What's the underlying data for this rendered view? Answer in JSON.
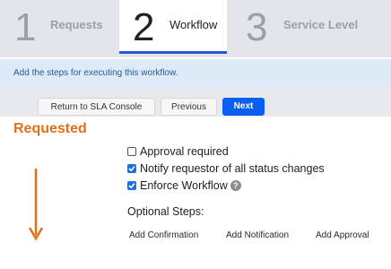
{
  "steps": [
    {
      "number": "1",
      "label": "Requests"
    },
    {
      "number": "2",
      "label": "Workflow"
    },
    {
      "number": "3",
      "label": "Service Level"
    }
  ],
  "active_step": 2,
  "banner": {
    "text": "Add the steps for executing this workflow."
  },
  "buttons": {
    "return_label": "Return to SLA Console",
    "previous_label": "Previous",
    "next_label": "Next"
  },
  "section": {
    "heading": "Requested",
    "checkboxes": [
      {
        "label": "Approval required",
        "checked": false
      },
      {
        "label": "Notify requestor of all status changes",
        "checked": true
      },
      {
        "label": "Enforce Workflow",
        "checked": true
      }
    ],
    "help_glyph": "?",
    "optional_heading": "Optional Steps:",
    "optional_actions": [
      "Add Confirmation",
      "Add Notification",
      "Add Approval"
    ]
  },
  "colors": {
    "accent_blue": "#0a5ff0",
    "heading_orange": "#e0701a",
    "arrow_orange": "#e0701a",
    "banner_bg": "#ddeaf8"
  },
  "icons": {
    "flow_arrow": "arrow-down-icon",
    "help": "help-icon",
    "check": "check-icon"
  }
}
